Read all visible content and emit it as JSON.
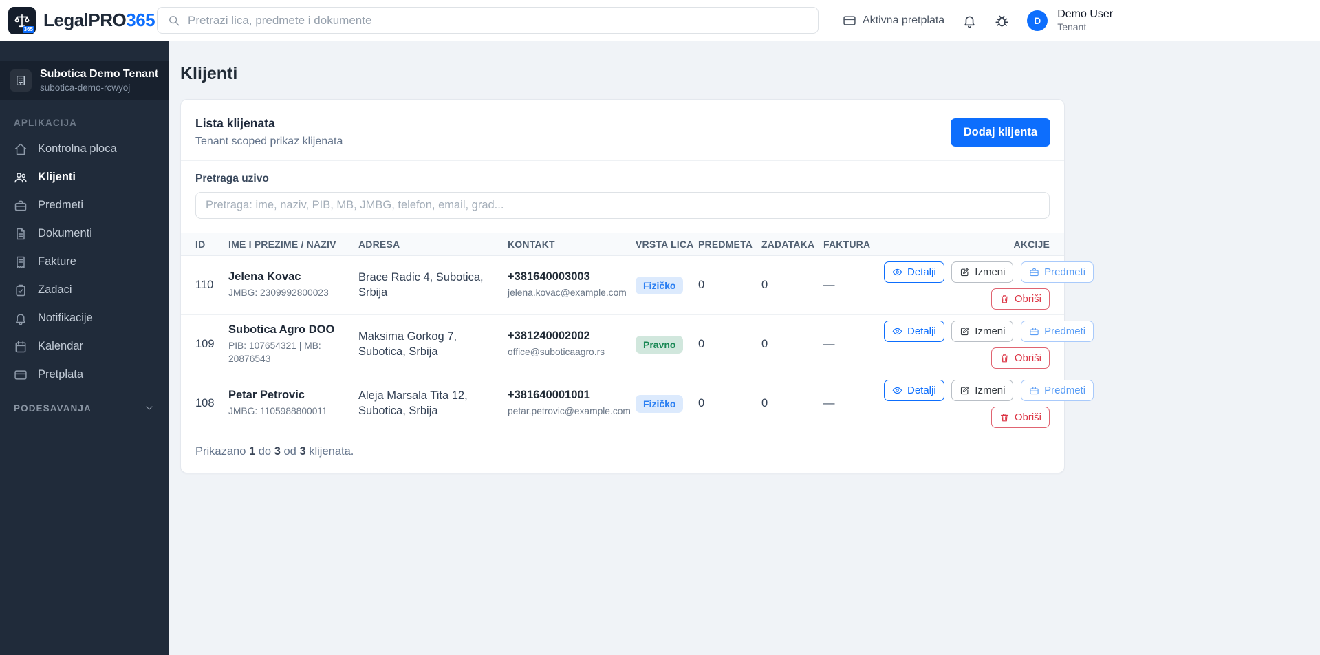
{
  "header": {
    "brand": {
      "name_primary": "LegalPRO",
      "name_accent": "365",
      "logo_badge": "365"
    },
    "search_placeholder": "Pretrazi lica, predmete i dokumente",
    "subscription_label": "Aktivna pretplata",
    "user": {
      "avatar_initial": "D",
      "name": "Demo User",
      "role": "Tenant"
    }
  },
  "sidebar": {
    "tenant": {
      "name": "Subotica Demo Tenant",
      "slug": "subotica-demo-rcwyoj"
    },
    "section_label": "APLIKACIJA",
    "items": [
      {
        "label": "Kontrolna ploca",
        "icon": "home-icon"
      },
      {
        "label": "Klijenti",
        "icon": "users-icon"
      },
      {
        "label": "Predmeti",
        "icon": "briefcase-icon"
      },
      {
        "label": "Dokumenti",
        "icon": "document-icon"
      },
      {
        "label": "Fakture",
        "icon": "invoice-icon"
      },
      {
        "label": "Zadaci",
        "icon": "tasks-icon"
      },
      {
        "label": "Notifikacije",
        "icon": "bell-icon"
      },
      {
        "label": "Kalendar",
        "icon": "calendar-icon"
      },
      {
        "label": "Pretplata",
        "icon": "credit-card-icon"
      }
    ],
    "settings_label": "PODESAVANJA"
  },
  "main": {
    "page_title": "Klijenti",
    "list_card": {
      "title": "Lista klijenata",
      "subtitle": "Tenant scoped prikaz klijenata",
      "add_button": "Dodaj klijenta",
      "search_label": "Pretraga uzivo",
      "search_placeholder": "Pretraga: ime, naziv, PIB, MB, JMBG, telefon, email, grad..."
    },
    "table": {
      "headers": [
        "ID",
        "IME I PREZIME / NAZIV",
        "ADRESA",
        "KONTAKT",
        "VRSTA LICA",
        "PREDMETA",
        "ZADATAKA",
        "FAKTURA",
        "AKCIJE"
      ],
      "rows": [
        {
          "id": "110",
          "name": "Jelena Kovac",
          "details": "JMBG: 2309992800023",
          "address": "Brace Radic 4, Subotica, Srbija",
          "phone": "+381640003003",
          "email": "jelena.kovac@example.com",
          "type_label": "Fizičko",
          "type_class": "badge badge-blue",
          "cases": "0",
          "tasks": "0",
          "invoices": "—"
        },
        {
          "id": "109",
          "name": "Subotica Agro DOO",
          "details": "PIB: 107654321 | MB: 20876543",
          "address": "Maksima Gorkog 7, Subotica, Srbija",
          "phone": "+381240002002",
          "email": "office@suboticaagro.rs",
          "type_label": "Pravno",
          "type_class": "badge badge-green",
          "cases": "0",
          "tasks": "0",
          "invoices": "—"
        },
        {
          "id": "108",
          "name": "Petar Petrovic",
          "details": "JMBG: 1105988800011",
          "address": "Aleja Marsala Tita 12, Subotica, Srbija",
          "phone": "+381640001001",
          "email": "petar.petrovic@example.com",
          "type_label": "Fizičko",
          "type_class": "badge badge-blue",
          "cases": "0",
          "tasks": "0",
          "invoices": "—"
        }
      ]
    },
    "actions": {
      "details": "Detalji",
      "edit": "Izmeni",
      "cases": "Predmeti",
      "delete": "Obriši"
    },
    "footer": {
      "prefix": "Prikazano",
      "from": "1",
      "to_word": "do",
      "to": "3",
      "of_word": "od",
      "total": "3",
      "suffix": "klijenata."
    }
  },
  "colors": {
    "accent": "#0d6efd",
    "sidebar_bg": "#202b3a",
    "badge_individual_text": "#2b7ff2",
    "badge_individual_bg": "#dceafd",
    "badge_legal_text": "#198754",
    "badge_legal_bg": "#d1e7dd",
    "danger": "#dc3545",
    "main_bg": "#f0f3f7"
  }
}
